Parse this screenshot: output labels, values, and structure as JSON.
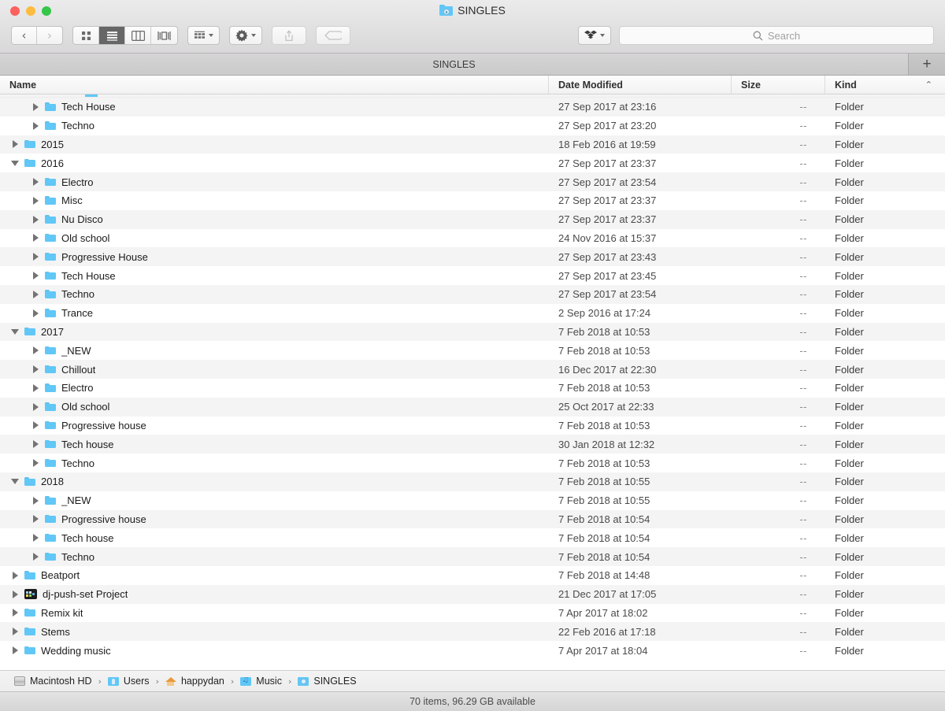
{
  "window": {
    "title": "SINGLES",
    "title_icon": "singles-folder-icon",
    "traffic_lights": [
      "close",
      "minimize",
      "zoom"
    ]
  },
  "toolbar": {
    "back_label": "‹",
    "forward_label": "›",
    "view_modes": [
      {
        "name": "icon-view",
        "icon": "icon-view-icon",
        "selected": false
      },
      {
        "name": "list-view",
        "icon": "list-view-icon",
        "selected": true
      },
      {
        "name": "column-view",
        "icon": "column-view-icon",
        "selected": false
      },
      {
        "name": "gallery-view",
        "icon": "gallery-view-icon",
        "selected": false
      }
    ],
    "group_by_label": "group-by-icon",
    "action_label": "gear-icon",
    "share_label": "share-icon",
    "tag_label": "tag-icon",
    "dropbox_label": "dropbox-icon",
    "share_disabled": true,
    "tag_disabled": true
  },
  "search": {
    "placeholder": "Search",
    "value": "",
    "icon": "search-icon"
  },
  "tabbar": {
    "active_tab": "SINGLES",
    "add_tab_label": "+"
  },
  "columns": {
    "name": "Name",
    "date_modified": "Date Modified",
    "size": "Size",
    "kind": "Kind",
    "sort_indicator": "⌃",
    "sorted_by": "Kind",
    "sort_ascending": true
  },
  "rows": [
    {
      "name": "Tech House",
      "depth": 2,
      "expanded": false,
      "icon": "folder-icon",
      "date": "27 Sep 2017 at 23:16",
      "size": "--",
      "kind": "Folder"
    },
    {
      "name": "Techno",
      "depth": 2,
      "expanded": false,
      "icon": "folder-icon",
      "date": "27 Sep 2017 at 23:20",
      "size": "--",
      "kind": "Folder"
    },
    {
      "name": "2015",
      "depth": 1,
      "expanded": false,
      "icon": "folder-icon",
      "date": "18 Feb 2016 at 19:59",
      "size": "--",
      "kind": "Folder"
    },
    {
      "name": "2016",
      "depth": 1,
      "expanded": true,
      "icon": "folder-icon",
      "date": "27 Sep 2017 at 23:37",
      "size": "--",
      "kind": "Folder"
    },
    {
      "name": "Electro",
      "depth": 2,
      "expanded": false,
      "icon": "folder-icon",
      "date": "27 Sep 2017 at 23:54",
      "size": "--",
      "kind": "Folder"
    },
    {
      "name": "Misc",
      "depth": 2,
      "expanded": false,
      "icon": "folder-icon",
      "date": "27 Sep 2017 at 23:37",
      "size": "--",
      "kind": "Folder"
    },
    {
      "name": "Nu Disco",
      "depth": 2,
      "expanded": false,
      "icon": "folder-icon",
      "date": "27 Sep 2017 at 23:37",
      "size": "--",
      "kind": "Folder"
    },
    {
      "name": "Old school",
      "depth": 2,
      "expanded": false,
      "icon": "folder-icon",
      "date": "24 Nov 2016 at 15:37",
      "size": "--",
      "kind": "Folder"
    },
    {
      "name": "Progressive House",
      "depth": 2,
      "expanded": false,
      "icon": "folder-icon",
      "date": "27 Sep 2017 at 23:43",
      "size": "--",
      "kind": "Folder"
    },
    {
      "name": "Tech House",
      "depth": 2,
      "expanded": false,
      "icon": "folder-icon",
      "date": "27 Sep 2017 at 23:45",
      "size": "--",
      "kind": "Folder"
    },
    {
      "name": "Techno",
      "depth": 2,
      "expanded": false,
      "icon": "folder-icon",
      "date": "27 Sep 2017 at 23:54",
      "size": "--",
      "kind": "Folder"
    },
    {
      "name": "Trance",
      "depth": 2,
      "expanded": false,
      "icon": "folder-icon",
      "date": "2 Sep 2016 at 17:24",
      "size": "--",
      "kind": "Folder"
    },
    {
      "name": "2017",
      "depth": 1,
      "expanded": true,
      "icon": "folder-icon",
      "date": "7 Feb 2018 at 10:53",
      "size": "--",
      "kind": "Folder"
    },
    {
      "name": "_NEW",
      "depth": 2,
      "expanded": false,
      "icon": "folder-icon",
      "date": "7 Feb 2018 at 10:53",
      "size": "--",
      "kind": "Folder"
    },
    {
      "name": "Chillout",
      "depth": 2,
      "expanded": false,
      "icon": "folder-icon",
      "date": "16 Dec 2017 at 22:30",
      "size": "--",
      "kind": "Folder"
    },
    {
      "name": "Electro",
      "depth": 2,
      "expanded": false,
      "icon": "folder-icon",
      "date": "7 Feb 2018 at 10:53",
      "size": "--",
      "kind": "Folder"
    },
    {
      "name": "Old school",
      "depth": 2,
      "expanded": false,
      "icon": "folder-icon",
      "date": "25 Oct 2017 at 22:33",
      "size": "--",
      "kind": "Folder"
    },
    {
      "name": "Progressive house",
      "depth": 2,
      "expanded": false,
      "icon": "folder-icon",
      "date": "7 Feb 2018 at 10:53",
      "size": "--",
      "kind": "Folder"
    },
    {
      "name": "Tech house",
      "depth": 2,
      "expanded": false,
      "icon": "folder-icon",
      "date": "30 Jan 2018 at 12:32",
      "size": "--",
      "kind": "Folder"
    },
    {
      "name": "Techno",
      "depth": 2,
      "expanded": false,
      "icon": "folder-icon",
      "date": "7 Feb 2018 at 10:53",
      "size": "--",
      "kind": "Folder"
    },
    {
      "name": "2018",
      "depth": 1,
      "expanded": true,
      "icon": "folder-icon",
      "date": "7 Feb 2018 at 10:55",
      "size": "--",
      "kind": "Folder"
    },
    {
      "name": "_NEW",
      "depth": 2,
      "expanded": false,
      "icon": "folder-icon",
      "date": "7 Feb 2018 at 10:55",
      "size": "--",
      "kind": "Folder"
    },
    {
      "name": "Progressive house",
      "depth": 2,
      "expanded": false,
      "icon": "folder-icon",
      "date": "7 Feb 2018 at 10:54",
      "size": "--",
      "kind": "Folder"
    },
    {
      "name": "Tech house",
      "depth": 2,
      "expanded": false,
      "icon": "folder-icon",
      "date": "7 Feb 2018 at 10:54",
      "size": "--",
      "kind": "Folder"
    },
    {
      "name": "Techno",
      "depth": 2,
      "expanded": false,
      "icon": "folder-icon",
      "date": "7 Feb 2018 at 10:54",
      "size": "--",
      "kind": "Folder"
    },
    {
      "name": "Beatport",
      "depth": 1,
      "expanded": false,
      "icon": "folder-icon",
      "date": "7 Feb 2018 at 14:48",
      "size": "--",
      "kind": "Folder"
    },
    {
      "name": "dj-push-set Project",
      "depth": 1,
      "expanded": false,
      "icon": "project-folder-icon",
      "date": "21 Dec 2017 at 17:05",
      "size": "--",
      "kind": "Folder"
    },
    {
      "name": "Remix kit",
      "depth": 1,
      "expanded": false,
      "icon": "folder-icon",
      "date": "7 Apr 2017 at 18:02",
      "size": "--",
      "kind": "Folder"
    },
    {
      "name": "Stems",
      "depth": 1,
      "expanded": false,
      "icon": "folder-icon",
      "date": "22 Feb 2016 at 17:18",
      "size": "--",
      "kind": "Folder"
    },
    {
      "name": "Wedding music",
      "depth": 1,
      "expanded": false,
      "icon": "folder-icon",
      "date": "7 Apr 2017 at 18:04",
      "size": "--",
      "kind": "Folder"
    }
  ],
  "pathbar": {
    "crumbs": [
      {
        "label": "Macintosh HD",
        "icon": "hard-drive-icon"
      },
      {
        "label": "Users",
        "icon": "users-folder-icon"
      },
      {
        "label": "happydan",
        "icon": "home-folder-icon"
      },
      {
        "label": "Music",
        "icon": "music-folder-icon"
      },
      {
        "label": "SINGLES",
        "icon": "singles-folder-icon"
      }
    ],
    "separator": "›"
  },
  "statusbar": {
    "text": "70 items, 96.29 GB available"
  },
  "colors": {
    "folder_blue": "#61c7f7",
    "chrome_grey": "#ecebec",
    "stripe_grey": "#f4f4f4"
  }
}
